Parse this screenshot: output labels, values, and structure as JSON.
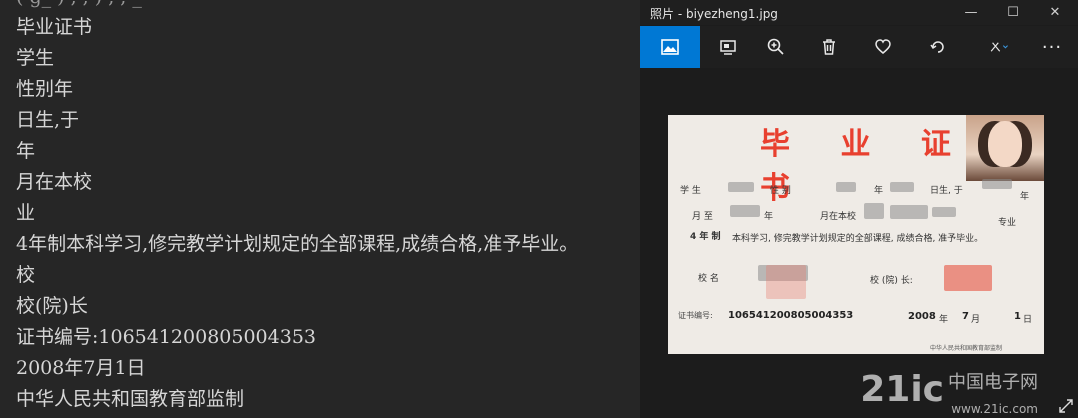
{
  "console": {
    "cut_top": "(  g_   )        ,         ,     )        ,         ,     _  ",
    "lines": [
      "毕业证书",
      "学生",
      "性别年",
      "日生,于",
      "年",
      "月在本校",
      "业",
      "4年制本科学习,修完教学计划规定的全部课程,成绩合格,准予毕业。",
      "校",
      "校(院)长",
      "证书编号:106541200805004353",
      "2008年7月1日",
      "中华人民共和国教育部监制"
    ]
  },
  "photos": {
    "title": "照片 - biyezheng1.jpg",
    "window_buttons": {
      "minimize": "—",
      "maximize": "☐",
      "close": "✕"
    },
    "toolbar": {
      "items": [
        "image-icon",
        "slideshow-icon",
        "zoom-in-icon",
        "delete-icon",
        "favorite-icon",
        "rotate-icon",
        "edit-icon"
      ],
      "more": "···"
    },
    "certificate": {
      "title": "毕 业 证 书",
      "student_label": "学 生",
      "gender_label": "性 别",
      "year_label": "年",
      "born_label": "日生, 于",
      "year2": "年",
      "month_label": "月 至",
      "year3": "年",
      "study_label": "月在本校",
      "major_label": "专业",
      "years": "4 年 制",
      "body": "本科学习, 修完教学计划规定的全部课程, 成绩合格, 准予毕业。",
      "school_label": "校 名",
      "president_label": "校 (院) 长:",
      "serial_label": "证书编号:",
      "serial": "106541200805004353",
      "year_val": "2008",
      "year_unit": "年",
      "month_val": "7",
      "month_unit": "月",
      "day_val": "1",
      "day_unit": "日",
      "footer": "中华人民共和国教育部监制"
    },
    "watermark": {
      "logo": "21ic",
      "cn": "中国电子网",
      "url": "www.21ic.com"
    }
  }
}
